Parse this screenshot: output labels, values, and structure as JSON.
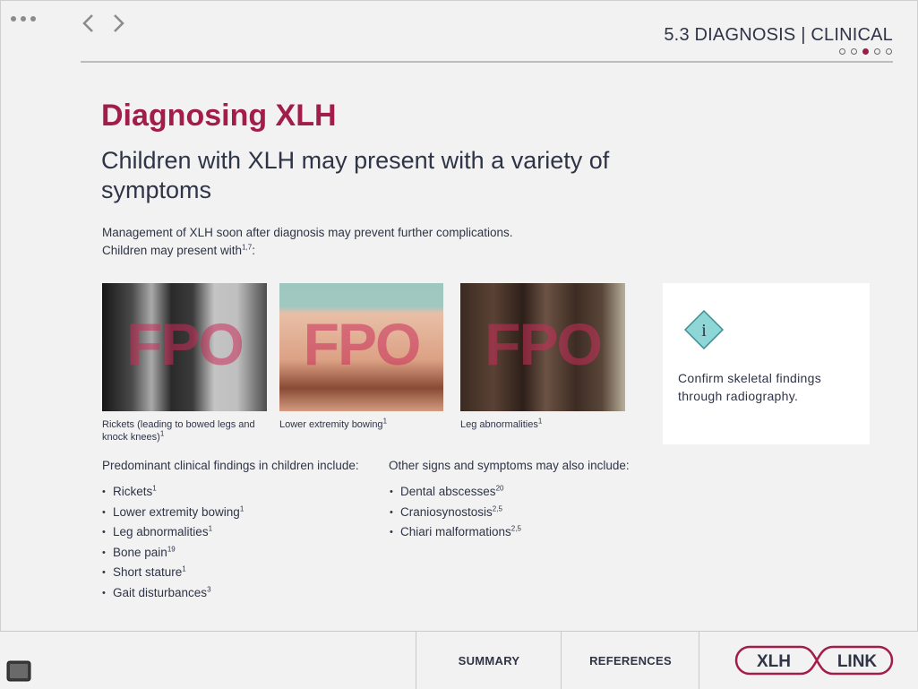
{
  "header": {
    "section": "5.3 DIAGNOSIS | CLINICAL",
    "pager_total": 5,
    "pager_active": 3
  },
  "content": {
    "title": "Diagnosing XLH",
    "subtitle": "Children with XLH may present with a variety of symptoms",
    "intro_line1": "Management of XLH soon after diagnosis may prevent further complications.",
    "intro_line2": "Children may present with",
    "intro_line2_sup": "1,7",
    "intro_line2_tail": ":"
  },
  "images": [
    {
      "placeholder": "FPO",
      "caption": "Rickets (leading to bowed legs and knock knees)",
      "sup": "1"
    },
    {
      "placeholder": "FPO",
      "caption": "Lower extremity bowing",
      "sup": "1"
    },
    {
      "placeholder": "FPO",
      "caption": "Leg abnormalities",
      "sup": "1"
    }
  ],
  "info_card": {
    "icon": "info-diamond-icon",
    "icon_glyph": "i",
    "text": "Confirm skeletal findings through radiography."
  },
  "list_primary": {
    "heading": "Predominant clinical findings in children include:",
    "items": [
      {
        "text": "Rickets",
        "sup": "1"
      },
      {
        "text": "Lower extremity bowing",
        "sup": "1"
      },
      {
        "text": "Leg abnormalities",
        "sup": "1"
      },
      {
        "text": "Bone pain",
        "sup": "19"
      },
      {
        "text": "Short stature",
        "sup": "1"
      },
      {
        "text": "Gait disturbances",
        "sup": "3"
      }
    ]
  },
  "list_secondary": {
    "heading": "Other signs and symptoms may also include:",
    "items": [
      {
        "text": "Dental abscesses",
        "sup": "20"
      },
      {
        "text": "Craniosynostosis",
        "sup": "2,5"
      },
      {
        "text": "Chiari malformations",
        "sup": "2,5"
      }
    ]
  },
  "footer": {
    "summary_label": "SUMMARY",
    "references_label": "REFERENCES",
    "logo_left": "XLH",
    "logo_right": "LINK"
  },
  "colors": {
    "accent": "#a31d4a",
    "text": "#2f3447",
    "info_teal": "#8fd6d6"
  }
}
